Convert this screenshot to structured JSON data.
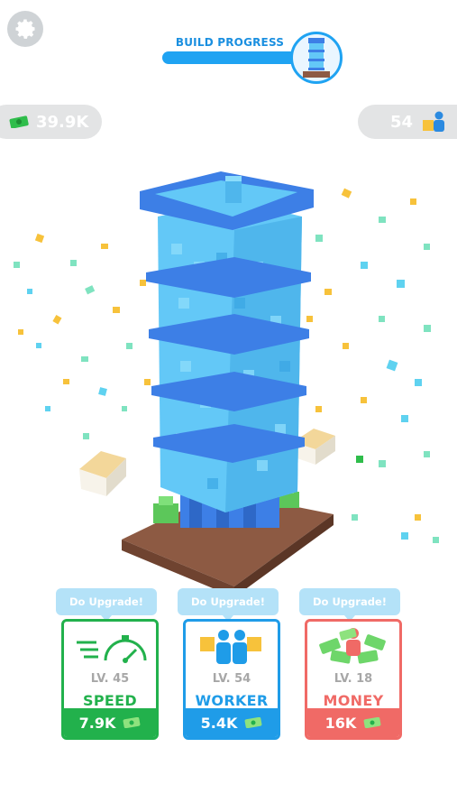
{
  "header": {
    "title": "BUILD PROGRESS",
    "progress": 0.97,
    "settings_icon": "gear-icon"
  },
  "resources": {
    "money": "39.9K",
    "workers": "54"
  },
  "cards": [
    {
      "tag": "Do Upgrade!",
      "level": "LV. 45",
      "name": "SPEED",
      "cost": "7.9K",
      "color": "#22b14c",
      "icon": "speedometer-icon"
    },
    {
      "tag": "Do Upgrade!",
      "level": "LV. 54",
      "name": "WORKER",
      "cost": "5.4K",
      "color": "#1f9ce8",
      "icon": "workers-icon"
    },
    {
      "tag": "Do Upgrade!",
      "level": "LV. 18",
      "name": "MONEY",
      "cost": "16K",
      "color": "#f06a66",
      "icon": "money-pile-icon"
    }
  ],
  "colors": {
    "accent": "#1fa3f2",
    "tower": "#63c8f7",
    "tower_dark": "#3d7fe6",
    "ground": "#8d5a43"
  }
}
